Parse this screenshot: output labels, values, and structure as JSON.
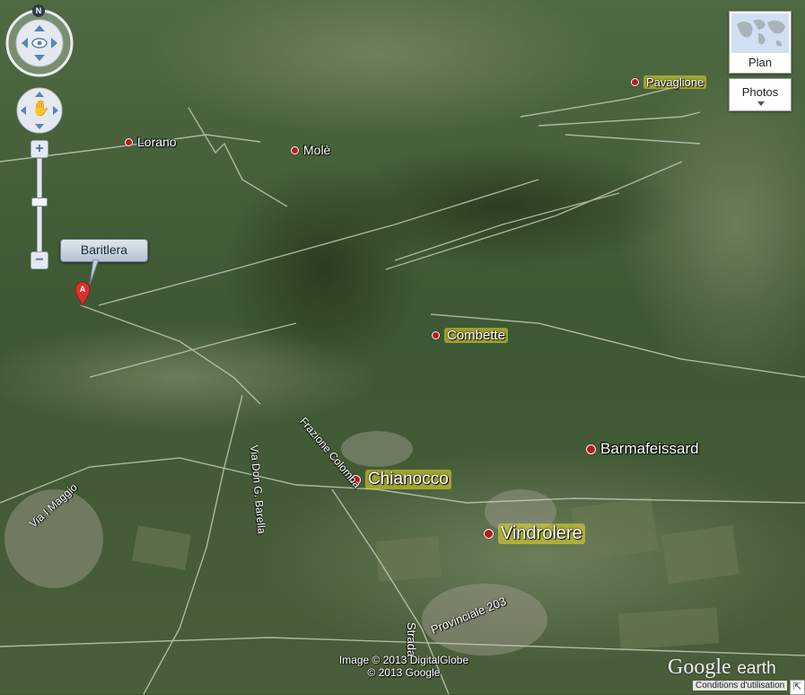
{
  "map_type_buttons": {
    "plan_label": "Plan",
    "photos_label": "Photos"
  },
  "navigation": {
    "north_label": "N"
  },
  "marker": {
    "label": "Baritlera"
  },
  "places": {
    "lorano": "Lorano",
    "mole": "Molè",
    "pavaglione": "Pavaglione",
    "combette": "Combette",
    "barmafeissard": "Barmafeissard",
    "chianocco": "Chianocco",
    "vindrolere": "Vindrolere"
  },
  "roads": {
    "via_don_barella": "Via Don G. Barella",
    "frazione_colomba": "Frazione Colomba",
    "via_maggio": "Via I Maggio",
    "strada_provinciale": "Provinciale 203",
    "strada_prefix": "Strada"
  },
  "attribution": {
    "line1": "Image © 2013 DigitalGlobe",
    "line2": "© 2013 Google",
    "brand_google": "Google",
    "brand_earth": "earth",
    "terms": "Conditions d'utilisation"
  },
  "colors": {
    "marker": "#d8322e",
    "place_dot": "#b71c1c",
    "highlight": "#e8dc28"
  }
}
